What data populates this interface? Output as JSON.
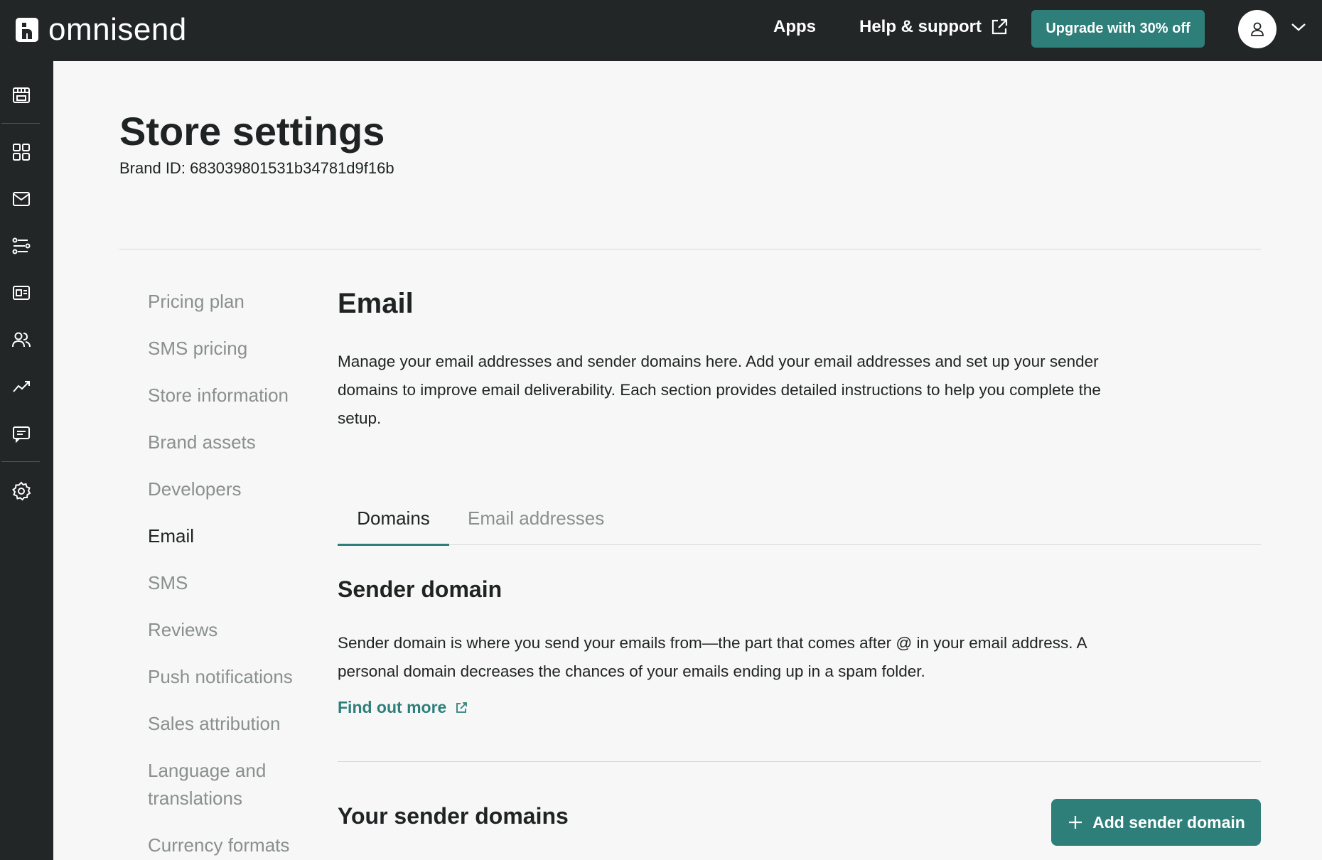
{
  "topbar": {
    "logo_text": "omnisend",
    "apps_label": "Apps",
    "help_label": "Help & support",
    "upgrade_label": "Upgrade with 30% off"
  },
  "sidebar": {
    "icons": [
      "store-icon",
      "dashboard-icon",
      "mail-icon",
      "automation-icon",
      "forms-icon",
      "audience-icon",
      "reports-icon",
      "sms-icon",
      "settings-icon"
    ]
  },
  "page": {
    "title": "Store settings",
    "brand_id_label": "Brand ID:",
    "brand_id_value": "683039801531b34781d9f16b"
  },
  "settings_nav": {
    "items": [
      {
        "label": "Pricing plan",
        "active": false
      },
      {
        "label": "SMS pricing",
        "active": false
      },
      {
        "label": "Store information",
        "active": false
      },
      {
        "label": "Brand assets",
        "active": false
      },
      {
        "label": "Developers",
        "active": false
      },
      {
        "label": "Email",
        "active": true
      },
      {
        "label": "SMS",
        "active": false
      },
      {
        "label": "Reviews",
        "active": false
      },
      {
        "label": "Push notifications",
        "active": false
      },
      {
        "label": "Sales attribution",
        "active": false
      },
      {
        "label": "Language and",
        "active": false
      },
      {
        "label": "translations",
        "active": false
      },
      {
        "label": "Currency formats",
        "active": false
      }
    ]
  },
  "email": {
    "title": "Email",
    "intro": "Manage your email addresses and sender domains here. Add your email addresses and set up your sender domains to improve email deliverability. Each section provides detailed instructions to help you complete the setup.",
    "tabs": [
      {
        "label": "Domains",
        "active": true
      },
      {
        "label": "Email addresses",
        "active": false
      }
    ],
    "sender_domain_title": "Sender domain",
    "sender_domain_desc": "Sender domain is where you send your emails from—the part that comes after @ in your email address. A personal domain decreases the chances of your emails ending up in a spam folder.",
    "find_out_more": "Find out more",
    "your_domains_title": "Your sender domains",
    "add_domain_label": "Add sender domain"
  },
  "colors": {
    "accent": "#2e7f7a",
    "topbar_bg": "#222626",
    "page_bg": "#f6f7f6"
  }
}
